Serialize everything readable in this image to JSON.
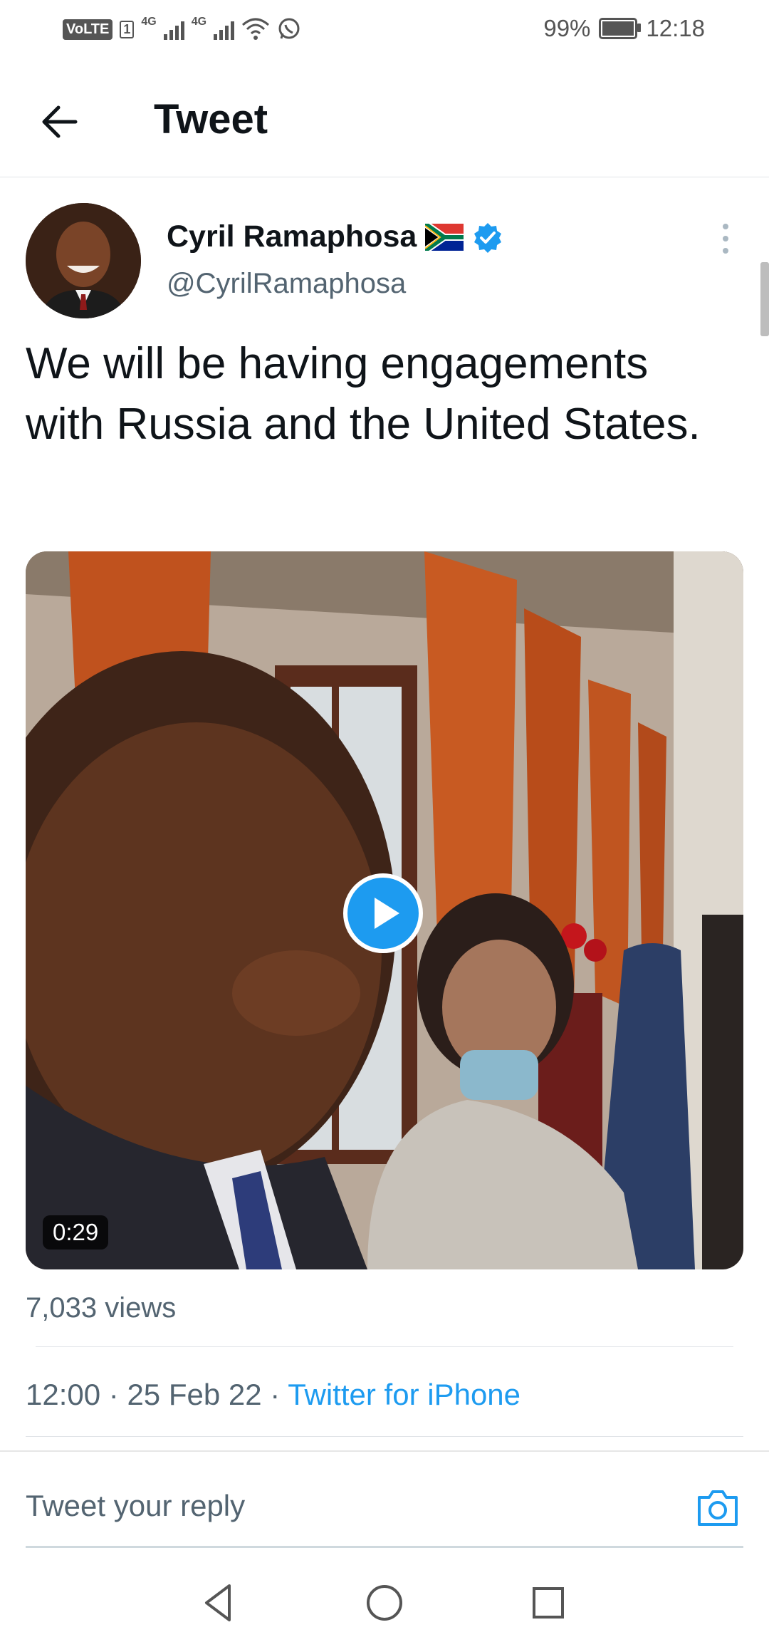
{
  "status_bar": {
    "volte": "VoLTE",
    "sim": "1",
    "network1": "4G",
    "network2": "4G",
    "battery_percent": "99%",
    "time": "12:18",
    "icons": [
      "signal-icon",
      "wifi-icon",
      "whatsapp-icon",
      "battery-icon"
    ]
  },
  "header": {
    "title": "Tweet",
    "back_icon": "arrow-left-icon"
  },
  "tweet": {
    "author_name": "Cyril Ramaphosa",
    "handle": "@CyrilRamaphosa",
    "flag_icon": "south-africa-flag-icon",
    "verified_icon": "verified-badge-icon",
    "text": "We will be having engagements with Russia and the United States.",
    "video": {
      "duration": "0:29",
      "play_icon": "play-icon"
    },
    "views": "7,033 views",
    "time": "12:00",
    "date": "25 Feb 22",
    "separator": "·",
    "source": "Twitter for iPhone"
  },
  "reply": {
    "placeholder": "Tweet your reply",
    "camera_icon": "camera-icon"
  },
  "colors": {
    "accent": "#1d9bf0",
    "secondary_text": "#536471",
    "primary_text": "#0f1419"
  },
  "nav_bar": {
    "icons": [
      "nav-back-icon",
      "nav-home-icon",
      "nav-recents-icon"
    ]
  }
}
